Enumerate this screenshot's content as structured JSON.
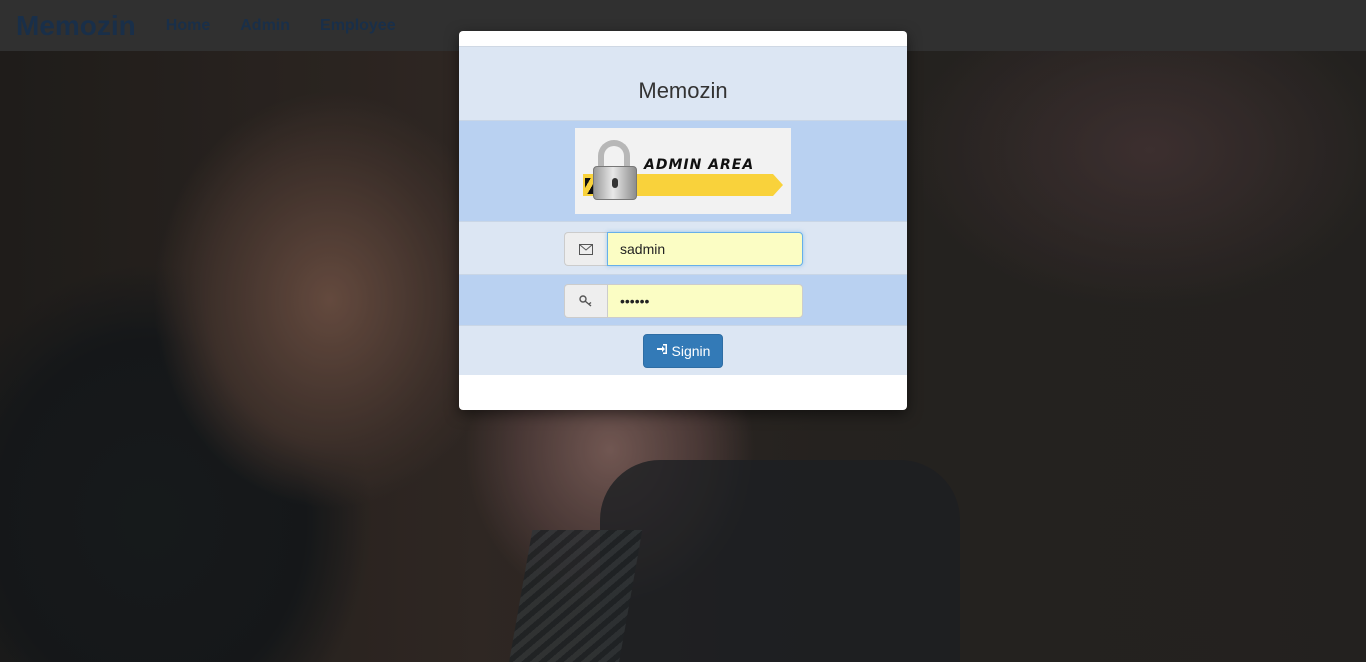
{
  "navbar": {
    "brand": "Memozin",
    "links": [
      "Home",
      "Admin",
      "Employee"
    ]
  },
  "modal": {
    "title": "Memozin",
    "banner_text": "ADMIN AREA",
    "email": {
      "icon": "envelope-icon",
      "value": "sadmin"
    },
    "password": {
      "icon": "key-icon",
      "value": "••••••"
    },
    "signin_button": {
      "icon": "sign-in-icon",
      "label": "Signin"
    }
  },
  "colors": {
    "primary": "#337ab7",
    "row_light": "#dce6f3",
    "row_dark": "#b9d1f1",
    "autofill": "#fbfdc4",
    "nav_text": "#1f3a5a"
  }
}
